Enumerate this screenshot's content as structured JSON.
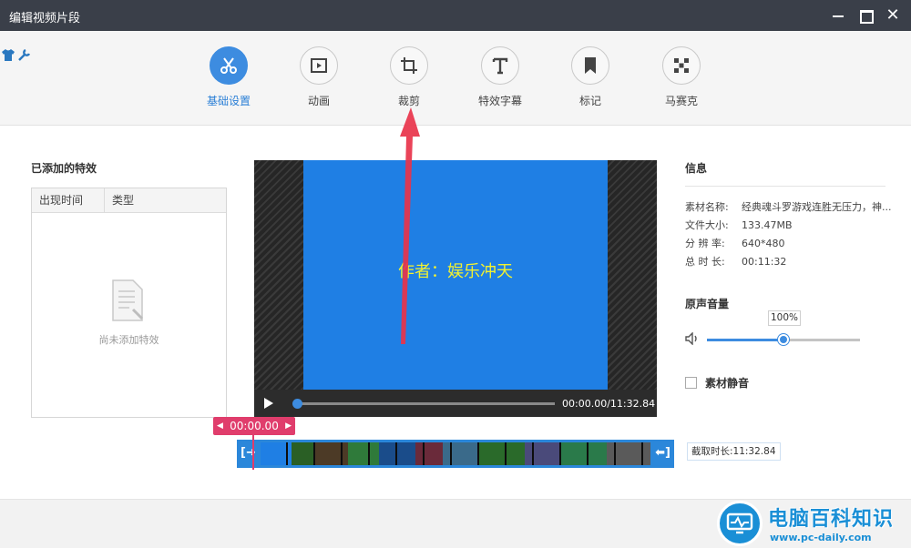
{
  "window": {
    "title": "编辑视频片段"
  },
  "toolbar": {
    "tools": [
      {
        "label": "基础设置",
        "icon": "scissors-icon",
        "active": true
      },
      {
        "label": "动画",
        "icon": "play-frame-icon",
        "active": false
      },
      {
        "label": "裁剪",
        "icon": "crop-icon",
        "active": false
      },
      {
        "label": "特效字幕",
        "icon": "text-t-icon",
        "active": false
      },
      {
        "label": "标记",
        "icon": "bookmark-icon",
        "active": false
      },
      {
        "label": "马赛克",
        "icon": "mosaic-icon",
        "active": false
      }
    ]
  },
  "effects": {
    "title": "已添加的特效",
    "columns": [
      "出现时间",
      "类型"
    ],
    "empty_text": "尚未添加特效"
  },
  "player": {
    "caption": "作者：娱乐冲天",
    "timecode": "00:00.00/11:32.84"
  },
  "timeline": {
    "current_time": "00:00.00",
    "clip_duration": "截取时长:11:32.84"
  },
  "info": {
    "title": "信息",
    "rows": [
      {
        "key": "素材名称:",
        "value": "经典魂斗罗游戏连胜无压力，神..."
      },
      {
        "key": "文件大小:",
        "value": "133.47MB"
      },
      {
        "key": "分 辨 率:",
        "value": "640*480"
      },
      {
        "key": "总 时 长:",
        "value": "00:11:32"
      }
    ]
  },
  "volume": {
    "title": "原声音量",
    "percent_label": "100%",
    "level": 0.5,
    "mute_label": "素材静音"
  },
  "watermark": {
    "text": "电脑百科知识",
    "url": "www.pc-daily.com"
  },
  "colors": {
    "accent": "#3d8ce0",
    "highlight": "#e03d6c",
    "titlebar": "#3a3f49"
  }
}
